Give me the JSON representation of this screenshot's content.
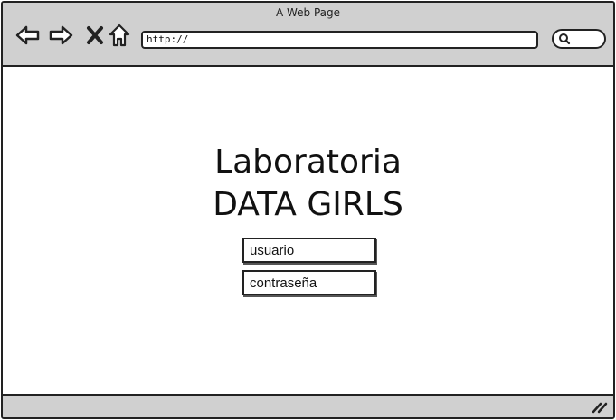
{
  "window": {
    "title": "A Web Page"
  },
  "toolbar": {
    "address_value": "http://",
    "icons": [
      "back-arrow-icon",
      "forward-arrow-icon",
      "close-x-icon",
      "home-icon",
      "search-icon"
    ]
  },
  "main": {
    "heading_line1": "Laboratoria",
    "heading_line2": "DATA GIRLS",
    "username_placeholder": "usuario",
    "password_placeholder": "contraseña"
  },
  "colors": {
    "chrome": "#d0d0d0",
    "outline": "#222222",
    "page": "#ffffff"
  }
}
